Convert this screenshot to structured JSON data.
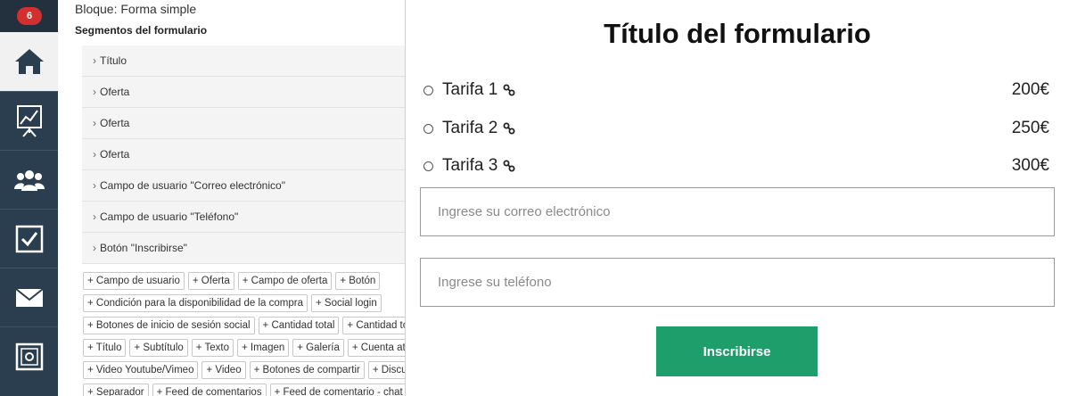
{
  "nav": {
    "badge_count": "6",
    "items": [
      {
        "icon": "home-icon",
        "active": true
      },
      {
        "icon": "chart-board-icon",
        "active": false
      },
      {
        "icon": "users-icon",
        "active": false
      },
      {
        "icon": "checkbox-icon",
        "active": false
      },
      {
        "icon": "mail-icon",
        "active": false
      },
      {
        "icon": "safe-icon",
        "active": false
      }
    ]
  },
  "editor": {
    "block_title": "Bloque: Forma simple",
    "segments_title": "Segmentos del formulario",
    "segments": [
      "Título",
      "Oferta",
      "Oferta",
      "Oferta",
      "Campo de usuario \"Correo electrónico\"",
      "Campo de usuario \"Teléfono\"",
      "Botón \"Inscribirse\""
    ],
    "tag_rows": [
      [
        "+ Campo de usuario",
        "+ Oferta",
        "+ Campo de oferta",
        "+ Botón"
      ],
      [
        "+ Condición para la disponibilidad de la compra",
        "+ Social login"
      ],
      [
        "+ Botones de inicio de sesión social",
        "+ Cantidad total",
        "+ Cantidad tota"
      ],
      [
        "+ Título",
        "+ Subtítulo",
        "+ Texto",
        "+ Imagen",
        "+ Galería",
        "+ Cuenta atrá"
      ],
      [
        "+ Video Youtube/Vimeo",
        "+ Video",
        "+ Botones de compartir",
        "+ Discurs"
      ],
      [
        "+ Separador",
        "+ Feed de comentarios",
        "+ Feed de comentario - chat"
      ]
    ]
  },
  "preview": {
    "title": "Título del formulario",
    "tariffs": [
      {
        "name": "Tarifa 1",
        "price": "200€"
      },
      {
        "name": "Tarifa 2",
        "price": "250€"
      },
      {
        "name": "Tarifa 3",
        "price": "300€"
      }
    ],
    "email_placeholder": "Ingrese su correo electrónico",
    "phone_placeholder": "Ingrese su teléfono",
    "submit_label": "Inscribirse"
  },
  "colors": {
    "rail_bg": "#2b3e50",
    "badge": "#d32f2f",
    "submit_bg": "#1e9e6a"
  }
}
